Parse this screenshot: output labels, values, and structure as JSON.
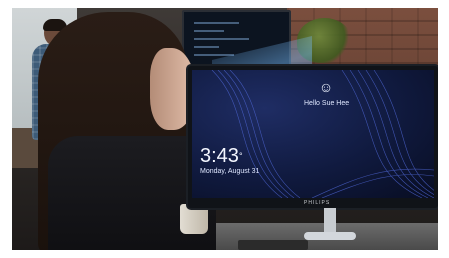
{
  "lock_screen": {
    "greeting": "Hello Sue Hee",
    "time": "3:43",
    "degree_suffix": "°",
    "date": "Monday, August 31",
    "face_icon": "smiley-icon"
  },
  "monitor": {
    "brand": "PHILIPS"
  },
  "colors": {
    "screen_bg": "#101a3f",
    "wave_lines": "#4f67d6",
    "beam": "#78b4ff"
  }
}
